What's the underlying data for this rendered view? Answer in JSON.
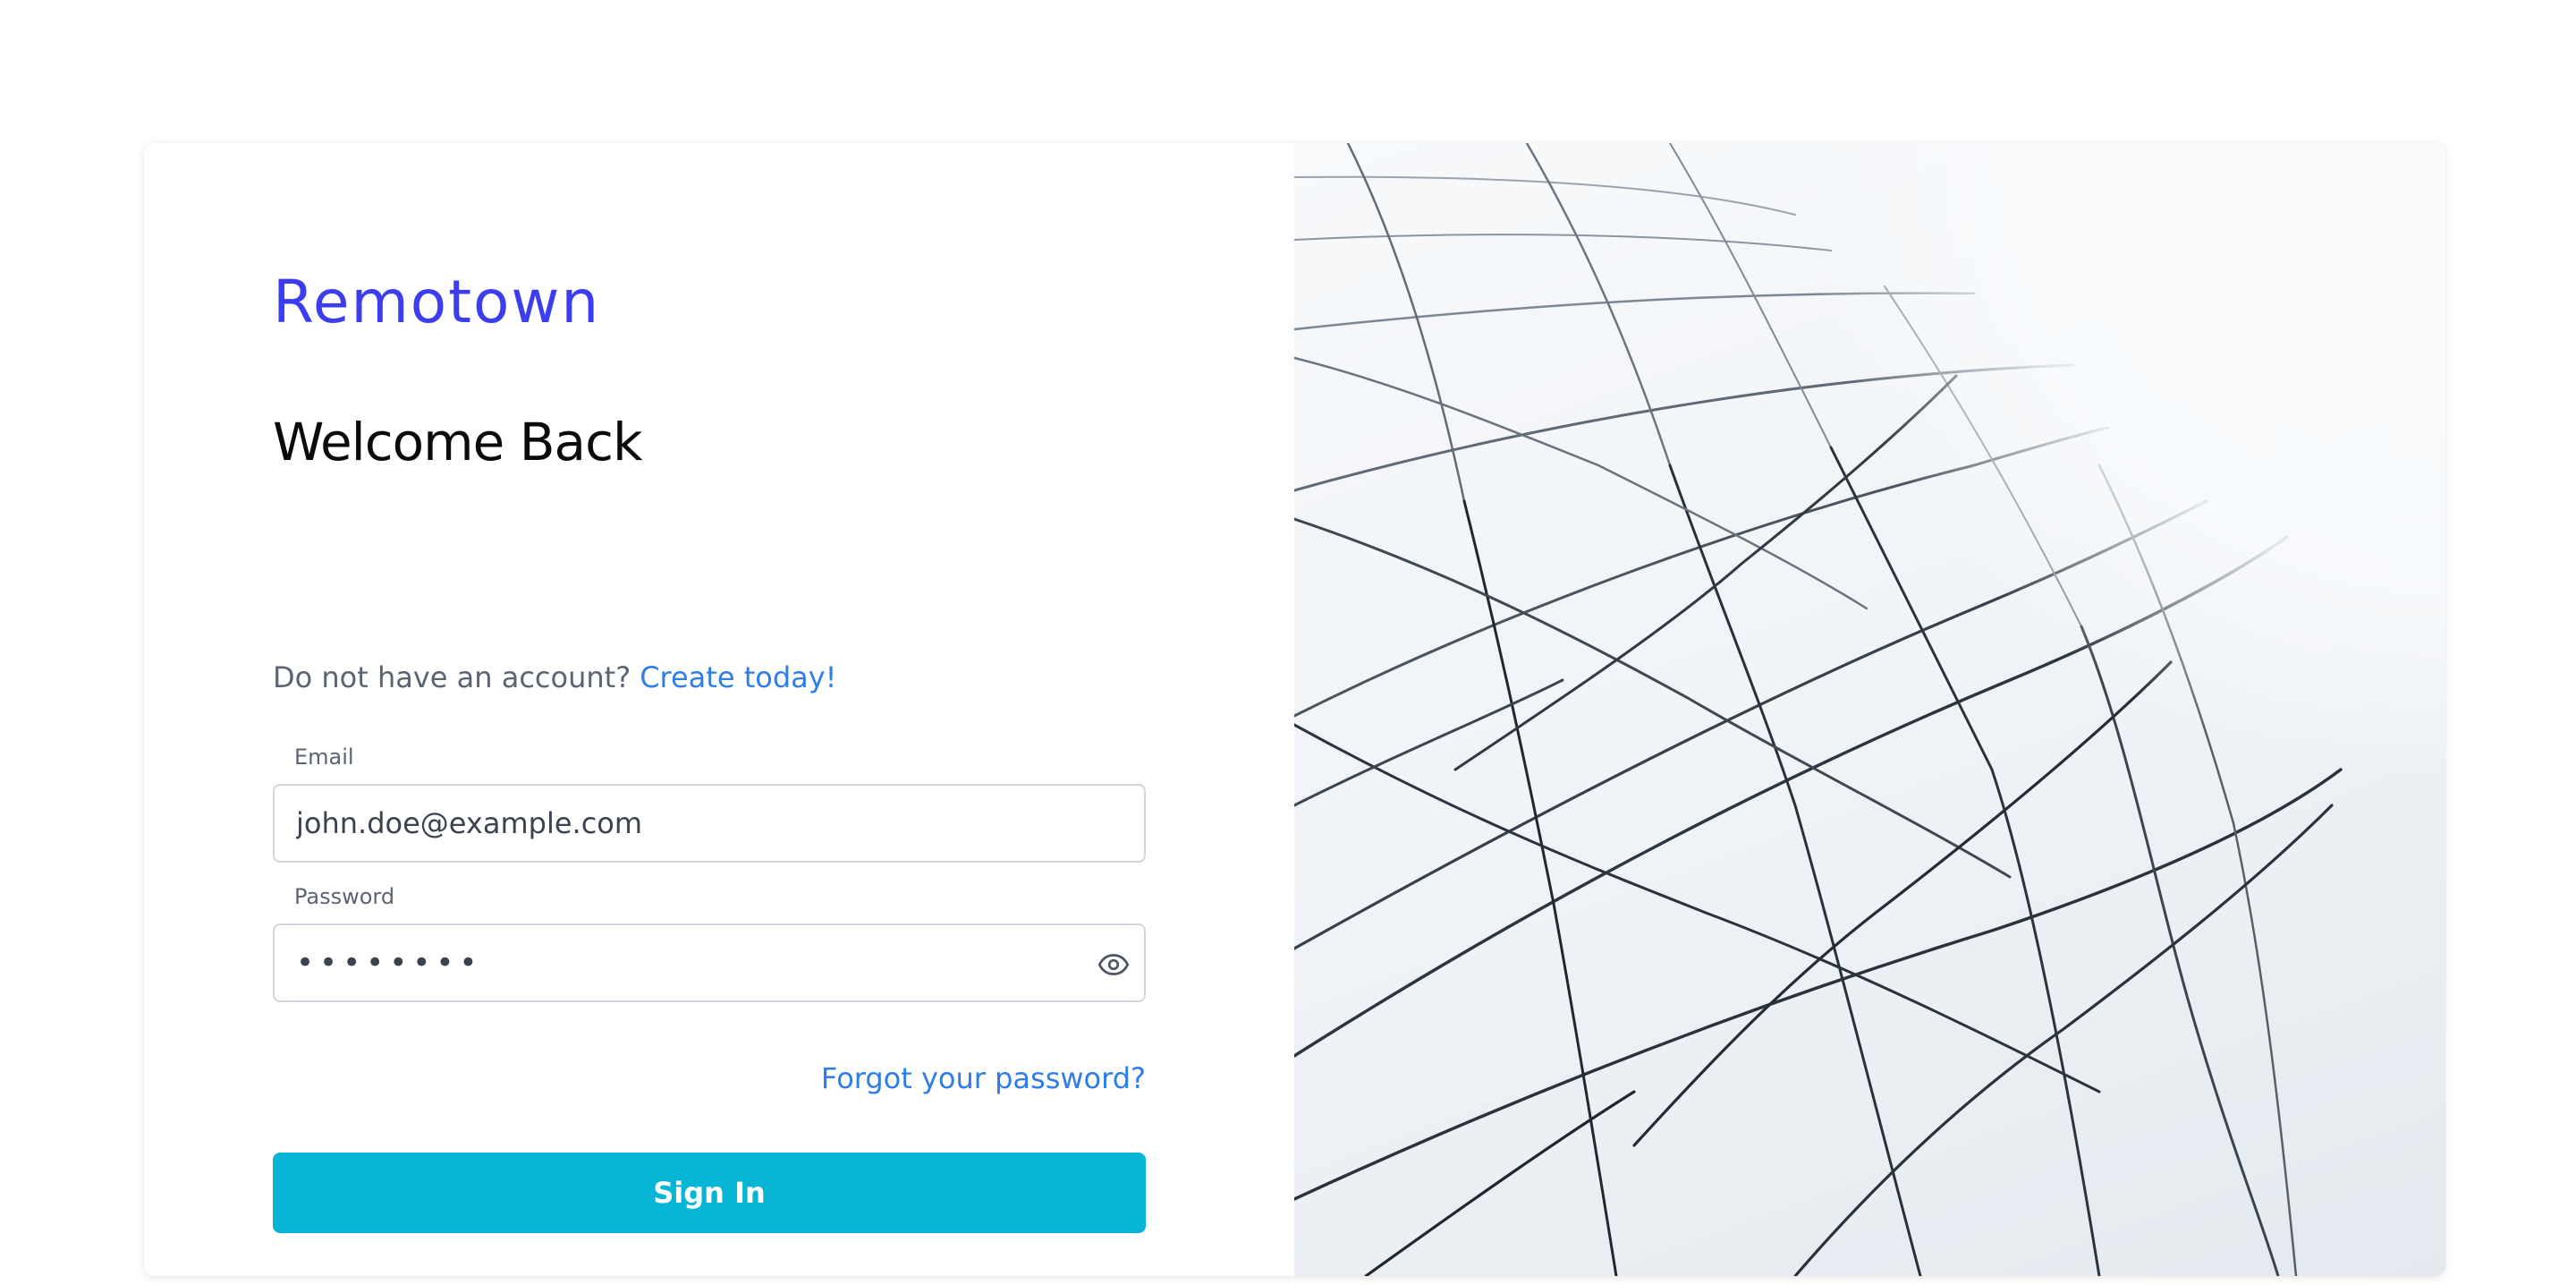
{
  "brand": {
    "logo_text": "Remotown",
    "brand_color": "#3d3df0"
  },
  "form": {
    "title": "Welcome Back",
    "signup_prompt": "Do not have an account?",
    "signup_link": "Create today!",
    "email_label": "Email",
    "email_value": "john.doe@example.com",
    "password_label": "Password",
    "password_value": "••••••••",
    "forgot_link": "Forgot your password?",
    "submit_label": "Sign In"
  },
  "hero_image": {
    "icon": "geodesic-dome-structure",
    "accent_color": "#06b6d4"
  }
}
